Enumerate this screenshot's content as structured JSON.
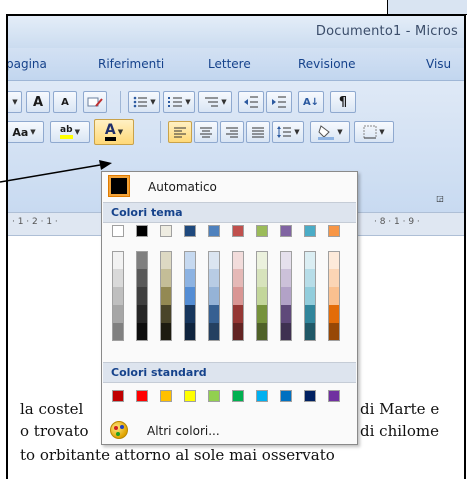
{
  "window": {
    "title": "Documento1 - Micros"
  },
  "tabs": [
    "pagina",
    "Riferimenti",
    "Lettere",
    "Revisione",
    "Visu"
  ],
  "ribbon": {
    "grow_font": "A",
    "shrink_font": "A",
    "change_case": "Aa",
    "highlight": "ab",
    "font_color": "A",
    "sort": "A↓",
    "paragraph_mark": "¶"
  },
  "ruler": {
    "left_marks": "· 1 · 2 · 1 ·",
    "right_marks": "· 8 · 1 · 9 ·"
  },
  "document": {
    "lines": [
      {
        "left": "la costel",
        "right": "di Marte e"
      },
      {
        "left": "o trovato",
        "right": "di chilome"
      },
      {
        "left": "to orbitante attorno al sole mai osservato",
        "right": ""
      }
    ]
  },
  "color_picker": {
    "automatic_label": "Automatico",
    "theme_header": "Colori tema",
    "standard_header": "Colori standard",
    "more_colors_label": "Altri colori...",
    "theme_colors": [
      "#FFFFFF",
      "#000000",
      "#EEECE1",
      "#1F497D",
      "#4F81BD",
      "#C0504D",
      "#9BBB59",
      "#8064A2",
      "#4BACC6",
      "#F79646"
    ],
    "theme_shades": [
      [
        "#F2F2F2",
        "#D9D9D9",
        "#BFBFBF",
        "#A6A6A6",
        "#808080"
      ],
      [
        "#7F7F7F",
        "#595959",
        "#3F3F3F",
        "#262626",
        "#0D0D0D"
      ],
      [
        "#DDD9C3",
        "#C4BD97",
        "#938953",
        "#494429",
        "#1D1B10"
      ],
      [
        "#C6D9F0",
        "#8DB3E2",
        "#548DD4",
        "#17365D",
        "#0F243E"
      ],
      [
        "#DBE5F1",
        "#B8CCE4",
        "#95B3D7",
        "#366092",
        "#244061"
      ],
      [
        "#F2DCDB",
        "#E5B9B7",
        "#D99694",
        "#953734",
        "#632423"
      ],
      [
        "#EBF1DD",
        "#D7E3BC",
        "#C3D69B",
        "#76923C",
        "#4F6128"
      ],
      [
        "#E5E0EC",
        "#CCC1D9",
        "#B2A2C7",
        "#5F497A",
        "#3F3151"
      ],
      [
        "#DBEEF3",
        "#B7DDE8",
        "#92CDDC",
        "#31859B",
        "#205867"
      ],
      [
        "#FDEADA",
        "#FBD5B5",
        "#FAC08F",
        "#E36C09",
        "#974806"
      ]
    ],
    "standard_colors": [
      "#C00000",
      "#FF0000",
      "#FFC000",
      "#FFFF00",
      "#92D050",
      "#00B050",
      "#00B0F0",
      "#0070C0",
      "#002060",
      "#7030A0"
    ]
  }
}
